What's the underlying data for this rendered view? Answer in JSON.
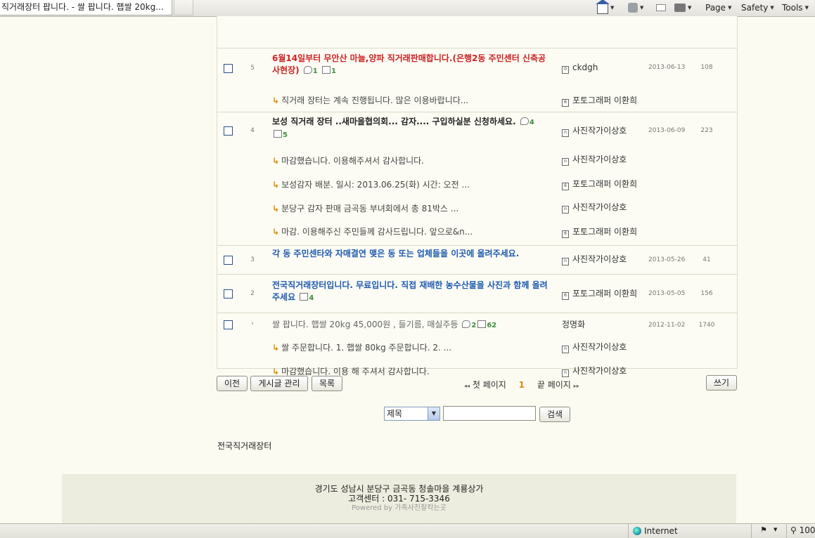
{
  "browser": {
    "tab_title": "직거래장터 팝니다. - 쌀 팝니다. 햅쌀 20kg...",
    "commands": [
      "Page",
      "Safety",
      "Tools"
    ],
    "status": {
      "zone": "Internet",
      "zoom": "100"
    }
  },
  "board": {
    "rows": [
      {
        "number": "5",
        "title": "6월14일부터 무안산 마늘,양파 직거래판매합니다.(은행2동 주민센터 신축공사현장)",
        "color": "red",
        "comments": "1",
        "files": "1",
        "author": "ckdgh",
        "author_icon": "0",
        "date": "2013-06-13",
        "views": "108"
      },
      {
        "reply": "직거래 장터는 계속 진행됩니다. 많은 이용바랍니다...",
        "author": "포토그래퍼 이환희",
        "author_icon": "6"
      },
      {
        "number": "4",
        "title": "보성 직거래 장터 ..새마을협의회... 감자.... 구입하실분 신청하세요.",
        "color": "dark",
        "comments": "4",
        "files": "5",
        "author": "사진작가이상호",
        "author_icon": "n",
        "date": "2013-06-09",
        "views": "223"
      },
      {
        "reply": "마감했습니다. 이용해주셔서 감사합니다.",
        "author": "사진작가이상호",
        "author_icon": "n"
      },
      {
        "reply": "보성감자 배분. 일시: 2013.06.25(화) 시간: 오전 ...",
        "author": "포토그래퍼 이환희",
        "author_icon": "6"
      },
      {
        "reply": "분당구 감자 판매 금곡동 부녀회에서 총 81박스 ...",
        "author": "사진작가이상호",
        "author_icon": "n"
      },
      {
        "reply": "마감. 이용해주신 주민들께 감사드립니다. 앞으로&n...",
        "author": "포토그래퍼 이환희",
        "author_icon": "6"
      },
      {
        "number": "3",
        "title": "각 동 주민센타와 자매결연 맺은 동 또는 업체들을 이곳에 올려주세요.",
        "color": "blue",
        "author": "사진작가이상호",
        "author_icon": "n",
        "date": "2013-05-26",
        "views": "41"
      },
      {
        "number": "2",
        "title": "전국직거래장터입니다. 무료입니다. 직접 재배한 농수산물을 사진과 함께 올려주세요",
        "color": "blue",
        "files": "4",
        "author": "포토그래퍼 이환희",
        "author_icon": "6",
        "date": "2013-05-05",
        "views": "156"
      },
      {
        "number": "›",
        "title": "쌀 팝니다. 햅쌀 20kg 45,000원 , 들기름, 매실주등",
        "color": "gray",
        "comments": "2",
        "files": "62",
        "author": "정명화",
        "date": "2012-11-02",
        "views": "1740"
      },
      {
        "reply": "쌀 주문합니다.   1. 햅쌀 80kg 주문합니다. 2. ...",
        "author": "사진작가이상호",
        "author_icon": "n"
      },
      {
        "reply": "마감했습니다. 이용 해 주셔서 감사합니다.",
        "author": "사진작가이상호",
        "author_icon": "n"
      }
    ]
  },
  "controls": {
    "prev": "이전",
    "manage": "게시글 관리",
    "list": "목록",
    "write": "쓰기",
    "first_page": "첫 페이지",
    "current_page": "1",
    "last_page": "끝 페이지",
    "search_field": "제목",
    "search_button": "검색"
  },
  "site_name": "전국직거래장터",
  "footer": {
    "address": "경기도 성남시 분당구 금곡동 청솔마을 계룡상가",
    "contact": "고객센터 : 031- 715-3346",
    "powered": "Powered by 가족사진찰칵는곳"
  }
}
